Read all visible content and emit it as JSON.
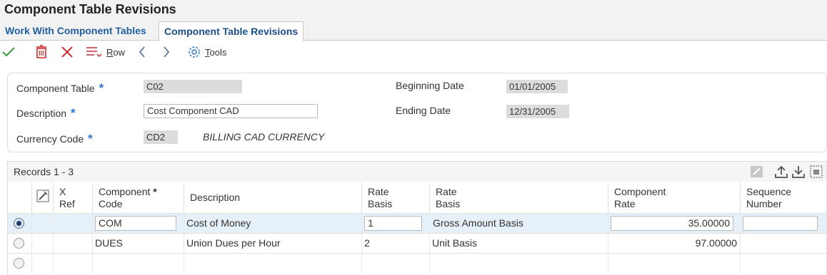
{
  "window": {
    "title": "Component Table Revisions"
  },
  "tabs": [
    {
      "label": "Work With Component Tables"
    },
    {
      "label": "Component Table Revisions"
    }
  ],
  "toolbar": {
    "icons": [
      "check-icon",
      "trash-icon",
      "x-icon",
      "row-menu-icon",
      "chevron-left-icon",
      "chevron-right-icon",
      "gear-icon"
    ],
    "row_label_first": "R",
    "row_label_rest": "ow",
    "tools_label_first": "T",
    "tools_label_rest": "ools",
    "accent": "#2a78c8"
  },
  "header": {
    "component_table": {
      "label": "Component Table",
      "value": "C02"
    },
    "description": {
      "label": "Description",
      "value": "Cost Component CAD"
    },
    "currency_code": {
      "label": "Currency Code",
      "value": "CD2",
      "description": "BILLING CAD CURRENCY"
    },
    "beginning_date": {
      "label": "Beginning Date",
      "value": "01/01/2005"
    },
    "ending_date": {
      "label": "Ending Date",
      "value": "12/31/2005"
    },
    "required_marker": "*"
  },
  "grid": {
    "records": "Records 1 - 3",
    "columns": {
      "xref_line1": "X",
      "xref_line2": "Ref",
      "comp_code_line1": "Component",
      "comp_code_line2": "Code",
      "description": "Description",
      "rate_basis_line1": "Rate",
      "rate_basis_line2": "Basis",
      "rate_basis_desc_line1": "Rate",
      "rate_basis_desc_line2": "Basis",
      "comp_rate_line1": "Component",
      "comp_rate_line2": "Rate",
      "seq_line1": "Sequence",
      "seq_line2": "Number"
    },
    "rows": [
      {
        "code": "COM",
        "description": "Cost of Money",
        "rate_basis": "1",
        "rate_basis_desc": "Gross Amount Basis",
        "rate": "35.00000",
        "sequence": ""
      },
      {
        "code": "DUES",
        "description": "Union Dues per Hour",
        "rate_basis": "2",
        "rate_basis_desc": "Unit Basis",
        "rate": "97.00000",
        "sequence": ""
      },
      {
        "code": "",
        "description": "",
        "rate_basis": "",
        "rate_basis_desc": "",
        "rate": "",
        "sequence": ""
      }
    ]
  }
}
